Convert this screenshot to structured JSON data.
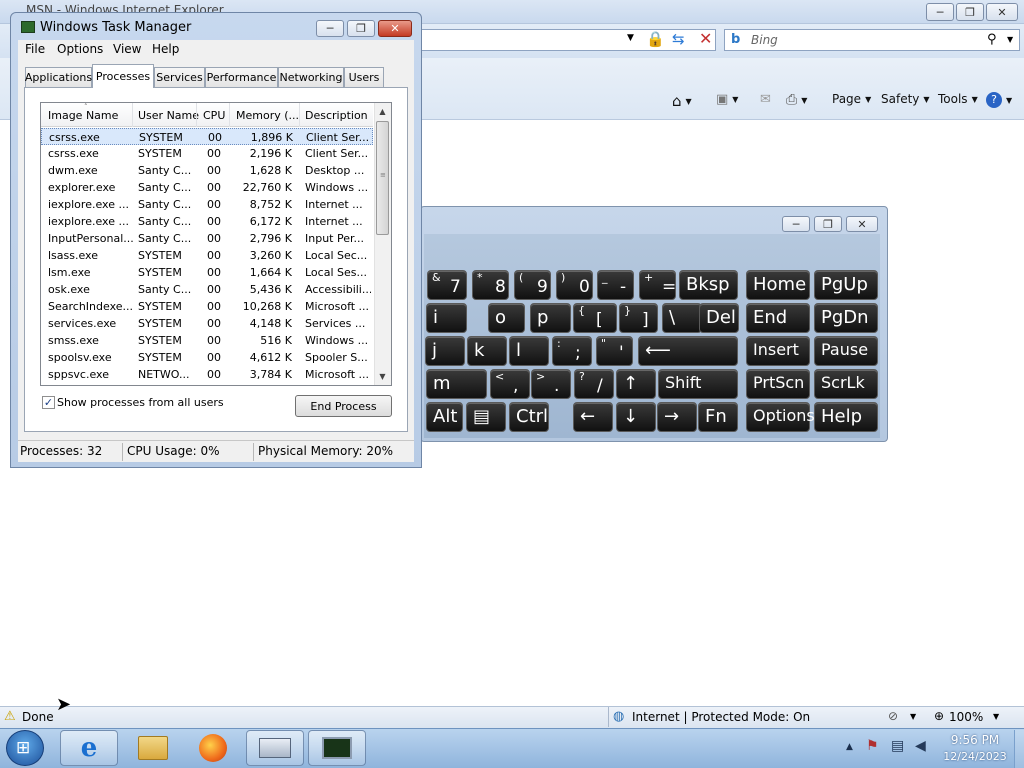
{
  "ie": {
    "title": "MSN - Windows Internet Explorer",
    "search_placeholder": "Bing",
    "commands": {
      "page": "Page",
      "safety": "Safety",
      "tools": "Tools"
    },
    "status_text": "Done",
    "zone_text": "Internet | Protected Mode: On",
    "zoom": "100%"
  },
  "taskmanager": {
    "title": "Windows Task Manager",
    "menu": [
      "File",
      "Options",
      "View",
      "Help"
    ],
    "tabs": [
      "Applications",
      "Processes",
      "Services",
      "Performance",
      "Networking",
      "Users"
    ],
    "selected_tab": "Processes",
    "columns": [
      "Image Name",
      "User Name",
      "CPU",
      "Memory (...",
      "Description"
    ],
    "rows": [
      [
        "csrss.exe",
        "SYSTEM",
        "00",
        "1,896 K",
        "Client Ser..."
      ],
      [
        "csrss.exe",
        "SYSTEM",
        "00",
        "2,196 K",
        "Client Ser..."
      ],
      [
        "dwm.exe",
        "Santy C...",
        "00",
        "1,628 K",
        "Desktop ..."
      ],
      [
        "explorer.exe",
        "Santy C...",
        "00",
        "22,760 K",
        "Windows ..."
      ],
      [
        "iexplore.exe ...",
        "Santy C...",
        "00",
        "8,752 K",
        "Internet ..."
      ],
      [
        "iexplore.exe ...",
        "Santy C...",
        "00",
        "6,172 K",
        "Internet ..."
      ],
      [
        "InputPersonal...",
        "Santy C...",
        "00",
        "2,796 K",
        "Input Per..."
      ],
      [
        "lsass.exe",
        "SYSTEM",
        "00",
        "3,260 K",
        "Local Sec..."
      ],
      [
        "lsm.exe",
        "SYSTEM",
        "00",
        "1,664 K",
        "Local Ses..."
      ],
      [
        "osk.exe",
        "Santy C...",
        "00",
        "5,436 K",
        "Accessibili..."
      ],
      [
        "SearchIndexe...",
        "SYSTEM",
        "00",
        "10,268 K",
        "Microsoft ..."
      ],
      [
        "services.exe",
        "SYSTEM",
        "00",
        "4,148 K",
        "Services ..."
      ],
      [
        "smss.exe",
        "SYSTEM",
        "00",
        "516 K",
        "Windows ..."
      ],
      [
        "spoolsv.exe",
        "SYSTEM",
        "00",
        "4,612 K",
        "Spooler S..."
      ],
      [
        "sppsvc.exe",
        "NETWO...",
        "00",
        "3,784 K",
        "Microsoft ..."
      ]
    ],
    "show_all_label": "Show processes from all users",
    "show_all_checked": true,
    "end_process": "End Process",
    "status": {
      "processes": "Processes: 32",
      "cpu": "CPU Usage: 0%",
      "memory": "Physical Memory: 20%"
    }
  },
  "osk": {
    "row1": [
      {
        "s": "&",
        "b": "7"
      },
      {
        "s": "*",
        "b": "8"
      },
      {
        "s": "(",
        "b": "9"
      },
      {
        "s": ")",
        "b": "0"
      },
      {
        "s": "_",
        "b": "-"
      },
      {
        "s": "+",
        "b": "="
      },
      {
        "m": "Bksp"
      },
      {
        "m": "Home"
      },
      {
        "m": "PgUp"
      }
    ],
    "row2": [
      {
        "m": "i"
      },
      {
        "m": "o"
      },
      {
        "m": "p"
      },
      {
        "s": "{",
        "b": "["
      },
      {
        "s": "}",
        "b": "]"
      },
      {
        "m": "\\"
      },
      {
        "m": "Del"
      },
      {
        "m": "End"
      },
      {
        "m": "PgDn"
      }
    ],
    "row3": [
      {
        "m": "j"
      },
      {
        "m": "k"
      },
      {
        "m": "l"
      },
      {
        "s": ":",
        "b": ";"
      },
      {
        "s": "\"",
        "b": "'"
      },
      {
        "m": "⟵"
      },
      {
        "m": "Insert"
      },
      {
        "m": "Pause"
      }
    ],
    "row4": [
      {
        "m": "m"
      },
      {
        "s": "<",
        "b": ","
      },
      {
        "s": ">",
        "b": "."
      },
      {
        "s": "?",
        "b": "/"
      },
      {
        "m": "↑"
      },
      {
        "m": "Shift"
      },
      {
        "m": "PrtScn"
      },
      {
        "m": "ScrLk"
      }
    ],
    "row5": [
      {
        "m": "Alt"
      },
      {
        "m": "▤"
      },
      {
        "m": "Ctrl"
      },
      {
        "m": "←"
      },
      {
        "m": "↓"
      },
      {
        "m": "→"
      },
      {
        "m": "Fn"
      },
      {
        "m": "Options"
      },
      {
        "m": "Help"
      }
    ]
  },
  "taskbar": {
    "time": "9:56 PM",
    "date": "12/24/2023"
  }
}
